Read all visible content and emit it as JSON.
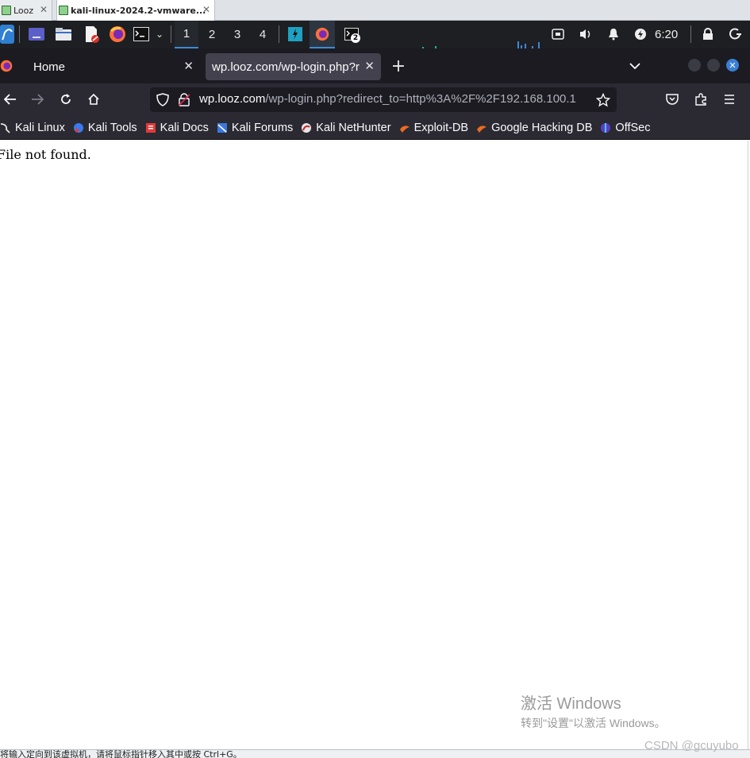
{
  "vmware": {
    "tabs": [
      {
        "label": "Looz"
      },
      {
        "label": "kali-linux-2024.2-vmware..."
      }
    ],
    "status_text": "将输入定向到该虚拟机，请将鼠标指针移入其中或按 Ctrl+G。"
  },
  "panel": {
    "workspaces": [
      "1",
      "2",
      "3",
      "4"
    ],
    "active_workspace": "1",
    "terminal_badge": "2",
    "clock": "6:20"
  },
  "browser": {
    "tabs": [
      {
        "label": "Home"
      },
      {
        "label": "wp.looz.com/wp-login.php?r"
      }
    ],
    "url": {
      "host": "wp.looz.com",
      "path": "/wp-login.php?redirect_to=http%3A%2F%2F192.168.100.1"
    },
    "bookmarks": [
      {
        "label": "Kali Linux",
        "icon": "kali-dragon-icon"
      },
      {
        "label": "Kali Tools",
        "icon": "kali-tools-icon"
      },
      {
        "label": "Kali Docs",
        "icon": "kali-docs-icon"
      },
      {
        "label": "Kali Forums",
        "icon": "kali-forums-icon"
      },
      {
        "label": "Kali NetHunter",
        "icon": "nethunter-icon"
      },
      {
        "label": "Exploit-DB",
        "icon": "exploit-db-icon"
      },
      {
        "label": "Google Hacking DB",
        "icon": "ghdb-icon"
      },
      {
        "label": "OffSec",
        "icon": "offsec-icon"
      }
    ]
  },
  "page": {
    "message": "File not found."
  },
  "overlay": {
    "activate_title": "激活 Windows",
    "activate_sub": "转到\"设置\"以激活 Windows。",
    "watermark": "CSDN @gcuyubo"
  },
  "colors": {
    "panel_bg": "#1d1f23",
    "firefox_chrome": "#2b2a33",
    "accent": "#3d8bd6"
  }
}
